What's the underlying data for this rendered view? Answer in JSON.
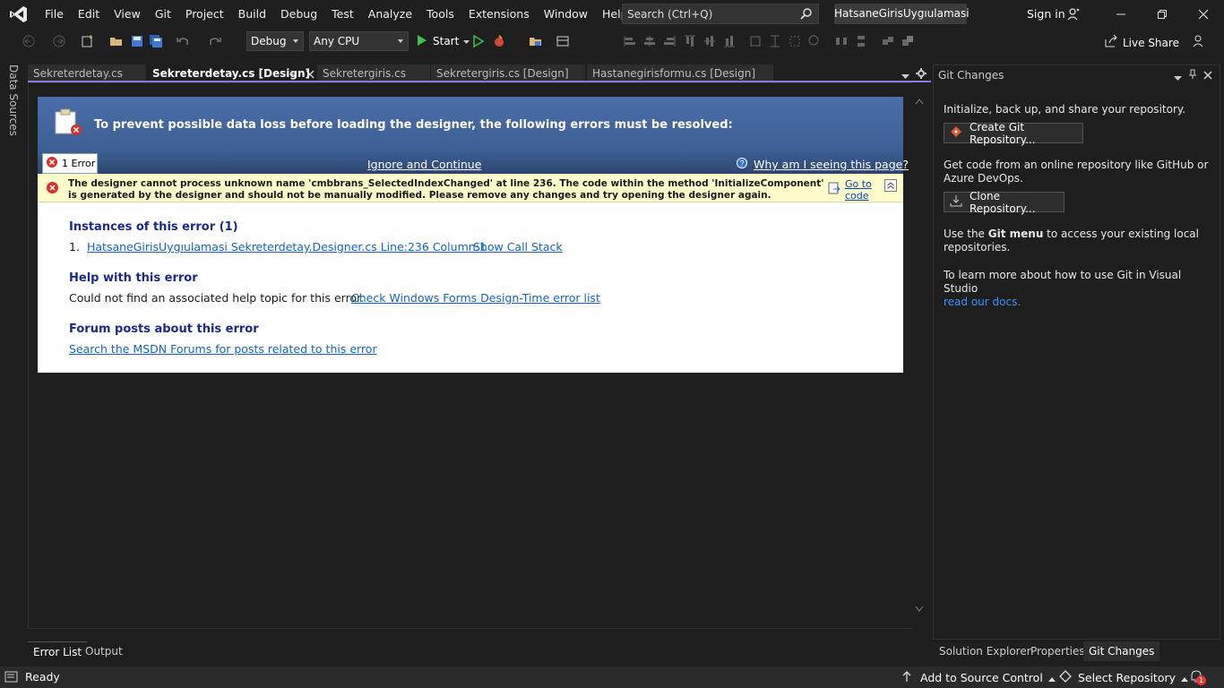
{
  "menu": {
    "items": [
      "File",
      "Edit",
      "View",
      "Git",
      "Project",
      "Build",
      "Debug",
      "Test",
      "Analyze",
      "Tools",
      "Extensions",
      "Window",
      "Help"
    ],
    "search_placeholder": "Search (Ctrl+Q)",
    "solution_name": "HatsaneGirisUygıulamasi",
    "sign_in": "Sign in"
  },
  "toolbar": {
    "configuration": "Debug",
    "platform": "Any CPU",
    "start_label": "Start",
    "live_share": "Live Share"
  },
  "left_strip": {
    "label": "Data Sources"
  },
  "doc_tabs": [
    {
      "label": "Sekreterdetay.cs",
      "active": false
    },
    {
      "label": "Sekreterdetay.cs [Design]",
      "active": true
    },
    {
      "label": "Sekretergiris.cs",
      "active": false
    },
    {
      "label": "Sekretergiris.cs [Design]",
      "active": false
    },
    {
      "label": "Hastanegirisformu.cs [Design]",
      "active": false
    }
  ],
  "error_page": {
    "title": "To prevent possible data loss before loading the designer, the following errors must be resolved:",
    "error_count": "1 Error",
    "ignore_continue": "Ignore and Continue",
    "why_link": "Why am I seeing this page?",
    "message": "The designer cannot process unknown name 'cmbbrans_SelectedIndexChanged' at line 236. The code within the method 'InitializeComponent' is generated by the designer and should not be manually modified. Please remove any changes and try opening the designer again.",
    "go_to_code": "Go to code",
    "instances_title": "Instances of this error (1)",
    "instance_number": "1.",
    "instance_link": "HatsaneGirisUygıulamasi Sekreterdetay.Designer.cs Line:236 Column:1",
    "show_call_stack": "Show Call Stack",
    "help_title": "Help with this error",
    "help_text": "Could not find an associated help topic for this error.",
    "help_link": "Check Windows Forms Design-Time error list",
    "forum_title": "Forum posts about this error",
    "forum_link": "Search the MSDN Forums for posts related to this error"
  },
  "git_panel": {
    "title": "Git Changes",
    "init_text": "Initialize, back up, and share your repository.",
    "create_button": "Create Git Repository...",
    "online_text": "Get code from an online repository like GitHub or Azure DevOps.",
    "clone_button": "Clone Repository...",
    "menu_text_prefix": "Use the ",
    "menu_text_bold": "Git menu",
    "menu_text_suffix": " to access your existing local repositories.",
    "learn_text": "To learn more about how to use Git in Visual Studio",
    "docs_link": "read our docs."
  },
  "bottom_tabs": [
    "Error List",
    "Output"
  ],
  "right_tabs": [
    "Solution Explorer",
    "Properties",
    "Git Changes"
  ],
  "status": {
    "ready": "Ready",
    "add_source_control": "Add to Source Control",
    "select_repository": "Select Repository",
    "notifications": "1"
  },
  "colors": {
    "accent": "#8a7bd6",
    "error_header": "#4a6ea9",
    "link": "#1164c3",
    "banner": "#fefccb"
  }
}
